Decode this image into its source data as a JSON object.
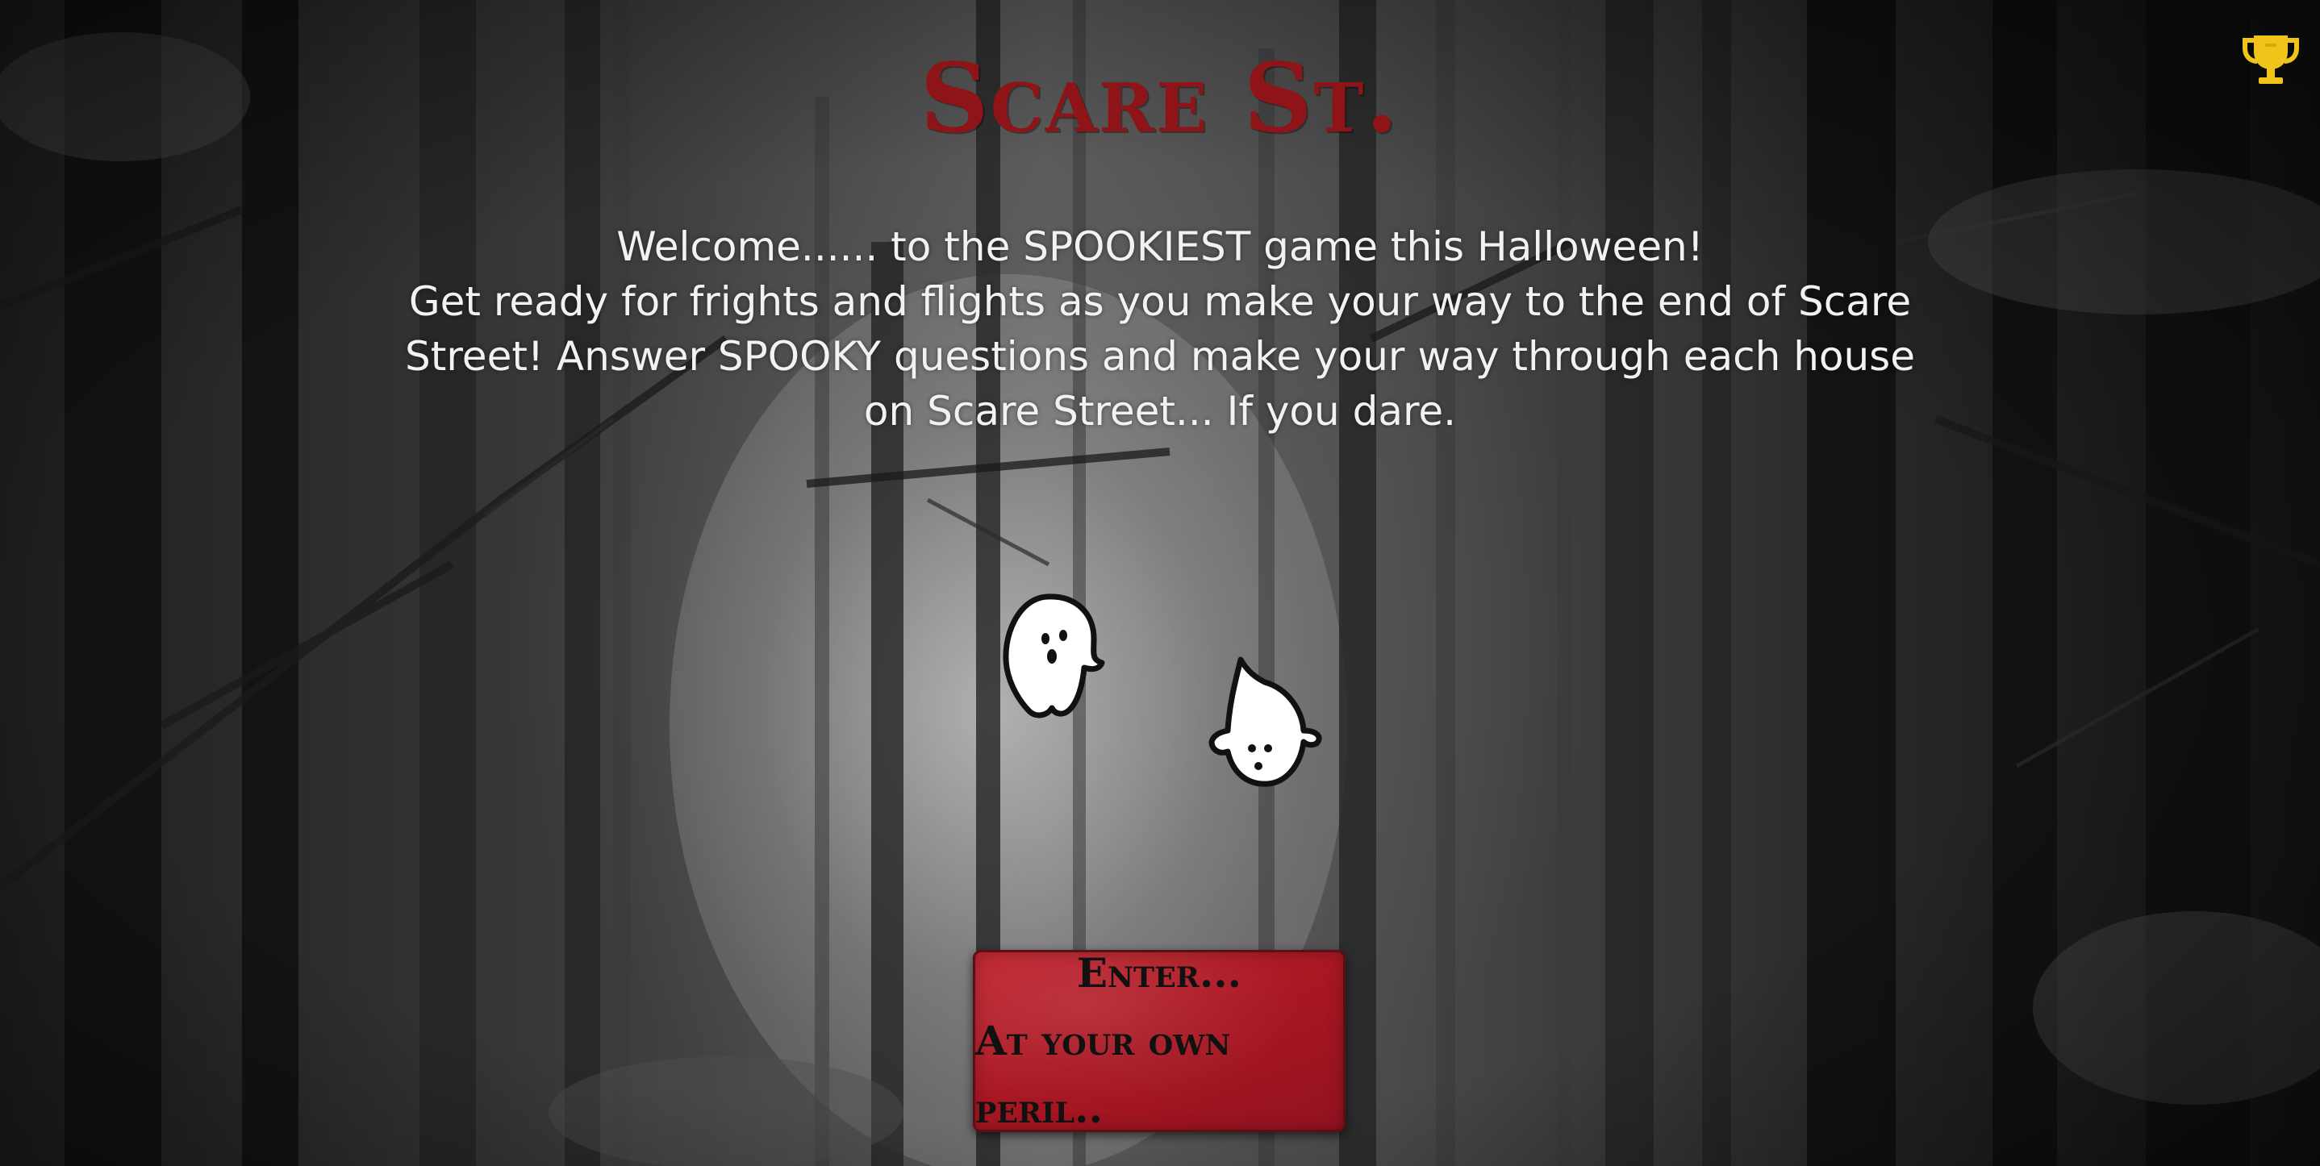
{
  "header": {
    "title": "Scare St.",
    "leaderboard_icon": "trophy-icon"
  },
  "intro": {
    "line1": "Welcome...... to the SPOOKIEST game this Halloween!",
    "line2": "Get ready for frights and flights as you make your way to the end of Scare Street! Answer SPOOKY questions and make your way through each house on Scare Street... If you dare."
  },
  "decorations": {
    "ghost_icon": "ghost-icon"
  },
  "start_button": {
    "line1": "Enter...",
    "line2": "At your own peril.."
  },
  "colors": {
    "title": "#8e1418",
    "button": "#b01b26",
    "trophy": "#f0c419",
    "text": "#f2f2f2"
  }
}
